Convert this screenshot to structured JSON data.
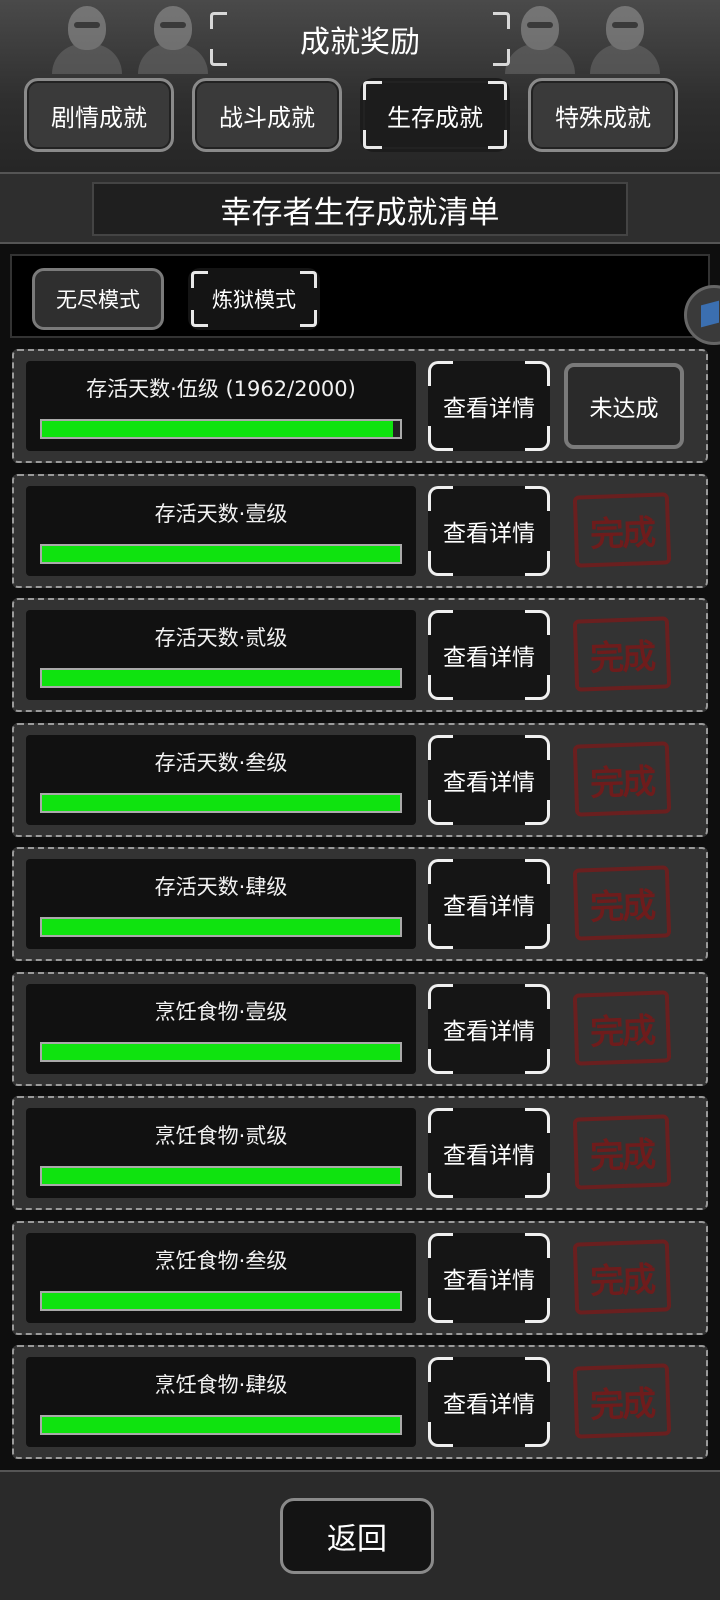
{
  "header": {
    "title": "成就奖励",
    "tabs": [
      {
        "label": "剧情成就",
        "active": false
      },
      {
        "label": "战斗成就",
        "active": false
      },
      {
        "label": "生存成就",
        "active": true
      },
      {
        "label": "特殊成就",
        "active": false
      }
    ]
  },
  "subtitle": "幸存者生存成就清单",
  "modes": [
    {
      "label": "无尽模式",
      "active": false
    },
    {
      "label": "炼狱模式",
      "active": true
    }
  ],
  "achievements": [
    {
      "name": "存活天数·伍级 (1962/2000)",
      "progress": 0.981,
      "detail_label": "查看详情",
      "status": "未达成",
      "completed": false
    },
    {
      "name": "存活天数·壹级",
      "progress": 1.0,
      "detail_label": "查看详情",
      "status": "完成",
      "completed": true
    },
    {
      "name": "存活天数·贰级",
      "progress": 1.0,
      "detail_label": "查看详情",
      "status": "完成",
      "completed": true
    },
    {
      "name": "存活天数·叁级",
      "progress": 1.0,
      "detail_label": "查看详情",
      "status": "完成",
      "completed": true
    },
    {
      "name": "存活天数·肆级",
      "progress": 1.0,
      "detail_label": "查看详情",
      "status": "完成",
      "completed": true
    },
    {
      "name": "烹饪食物·壹级",
      "progress": 1.0,
      "detail_label": "查看详情",
      "status": "完成",
      "completed": true
    },
    {
      "name": "烹饪食物·贰级",
      "progress": 1.0,
      "detail_label": "查看详情",
      "status": "完成",
      "completed": true
    },
    {
      "name": "烹饪食物·叁级",
      "progress": 1.0,
      "detail_label": "查看详情",
      "status": "完成",
      "completed": true
    },
    {
      "name": "烹饪食物·肆级",
      "progress": 1.0,
      "detail_label": "查看详情",
      "status": "完成",
      "completed": true
    }
  ],
  "footer": {
    "back_label": "返回"
  },
  "colors": {
    "progress": "#0fe30f",
    "stamp": "#6e1c1c"
  }
}
